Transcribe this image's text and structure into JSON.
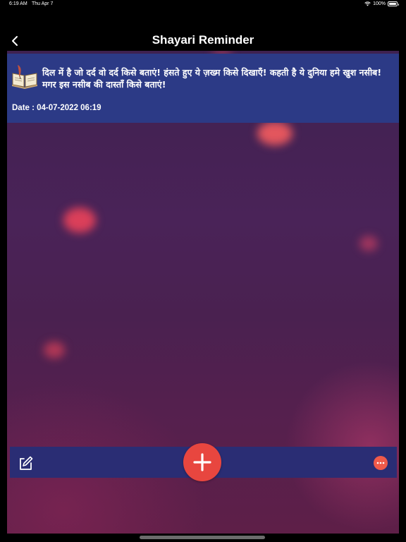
{
  "status_bar": {
    "time": "6:19 AM",
    "day": "Thu Apr 7",
    "battery": "100%",
    "wifi_icon": "wifi-icon",
    "battery_icon": "battery-icon"
  },
  "nav": {
    "title": "Shayari Reminder",
    "back_icon": "chevron-left-icon"
  },
  "quote": {
    "icon": "open-book-quill-icon",
    "text": "दिल में है जो दर्द वो दर्द किसे बताएं! हंसते हुए ये ज़ख्म किसे दिखाएँ! कहती है ये दुनिया हमे खुश नसीब! मगर इस नसीब की दास्ताँ किसे बताएं!",
    "date": "Date : 04-07-2022 06:19"
  },
  "toolbar": {
    "edit_icon": "edit-note-icon",
    "add_icon": "plus-icon",
    "more_icon": "more-dots-icon"
  },
  "colors": {
    "nav_background": "#000000",
    "card_background": "#2c3a86",
    "toolbar_background": "#2a2d74",
    "accent": "#e8463f"
  }
}
